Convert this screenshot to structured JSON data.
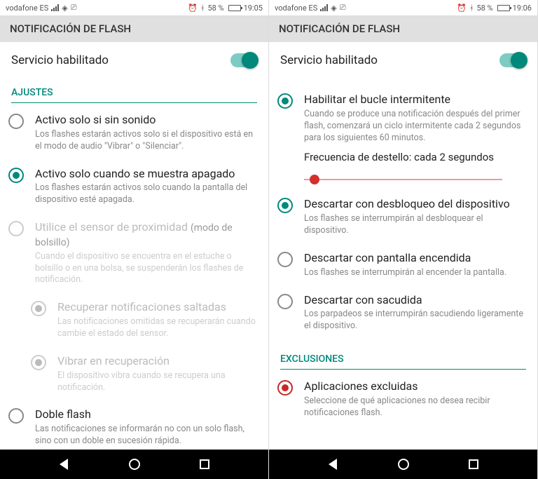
{
  "colors": {
    "accent": "#00897b",
    "danger": "#d32f2f"
  },
  "left": {
    "status": {
      "carrier": "vodafone ES",
      "battery_pct": "58 %",
      "time": "19:05"
    },
    "header": "NOTIFICACIÓN DE FLASH",
    "service": {
      "label": "Servicio habilitado"
    },
    "section_ajustes": "AJUSTES",
    "options": [
      {
        "title": "Activo solo si sin sonido",
        "desc": "Los flashes estarán activos solo si el dispositivo está en el modo de audio \"Vibrar\" o \"Silenciar\"."
      },
      {
        "title": "Activo solo cuando se muestra apagado",
        "desc": "Los flashes estarán activos solo cuando la pantalla del dispositivo esté apagada."
      },
      {
        "title": "Utilice el sensor de proximidad",
        "hint": "(modo de bolsillo)",
        "desc": "Cuando el dispositivo se encuentra en el estuche o bolsillo o en una bolsa, se suspenderán los flashes de notificación."
      },
      {
        "title": "Recuperar notificaciones saltadas",
        "desc": "Las notificaciones omitidas se recuperarán cuando cambie el estado del sensor."
      },
      {
        "title": "Vibrar en recuperación",
        "desc": "El dispositivo vibra cuando se recupera una notificación."
      },
      {
        "title": "Doble flash",
        "desc": "Las notificaciones se informarán no con un solo flash, sino con un doble en sucesión rápida."
      }
    ]
  },
  "right": {
    "status": {
      "carrier": "vodafone ES",
      "battery_pct": "58 %",
      "time": "19:06"
    },
    "header": "NOTIFICACIÓN DE FLASH",
    "service": {
      "label": "Servicio habilitado"
    },
    "options": [
      {
        "title": "Habilitar el bucle intermitente",
        "desc": "Cuando se produce una notificación después del primer flash, comenzará un ciclo intermitente cada 2 segundos para los siguientes 60 minutos."
      }
    ],
    "slider_label": "Frecuencia de destello: cada 2 segundos",
    "dismiss": [
      {
        "title": "Descartar con desbloqueo del dispositivo",
        "desc": "Los flashes se interrumpirán al desbloquear el dispositivo."
      },
      {
        "title": "Descartar con pantalla encendida",
        "desc": "Los flashes se interrumpirán al encender la pantalla."
      },
      {
        "title": "Descartar con sacudida",
        "desc": "Los parpadeos se interrumpirán sacudiendo ligeramente el dispositivo."
      }
    ],
    "section_exclusiones": "EXCLUSIONES",
    "exclusions": {
      "title": "Aplicaciones excluidas",
      "desc": "Seleccione de qué aplicaciones no desea recibir notificaciones flash."
    }
  }
}
